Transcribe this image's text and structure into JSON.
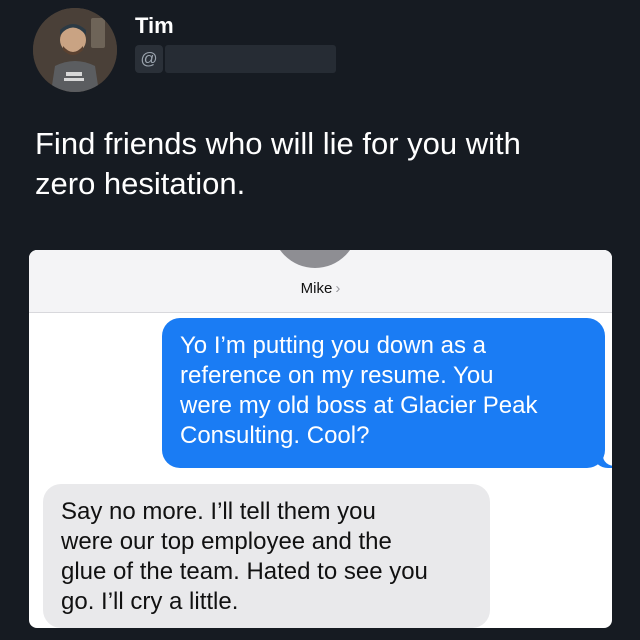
{
  "post": {
    "author_name": "Tim",
    "handle_prefix": "@",
    "text": "Find friends who will lie for you with\nzero hesitation."
  },
  "conversation": {
    "contact_name": "Mike",
    "header_chevron": "›",
    "messages": [
      {
        "direction": "outgoing",
        "text": "Yo I’m putting you down as a\nreference on my resume. You\nwere my old boss at Glacier Peak\nConsulting. Cool?"
      },
      {
        "direction": "incoming",
        "text": "Say no more. I’ll tell them you\nwere our top employee and the\nglue of the team. Hated to see you\ngo. I’ll cry a little."
      }
    ]
  },
  "colors": {
    "background": "#161b22",
    "outgoing_bubble": "#1a7cf4",
    "incoming_bubble": "#e9e9eb"
  },
  "icons": {
    "chevron": "chevron-right-icon"
  }
}
